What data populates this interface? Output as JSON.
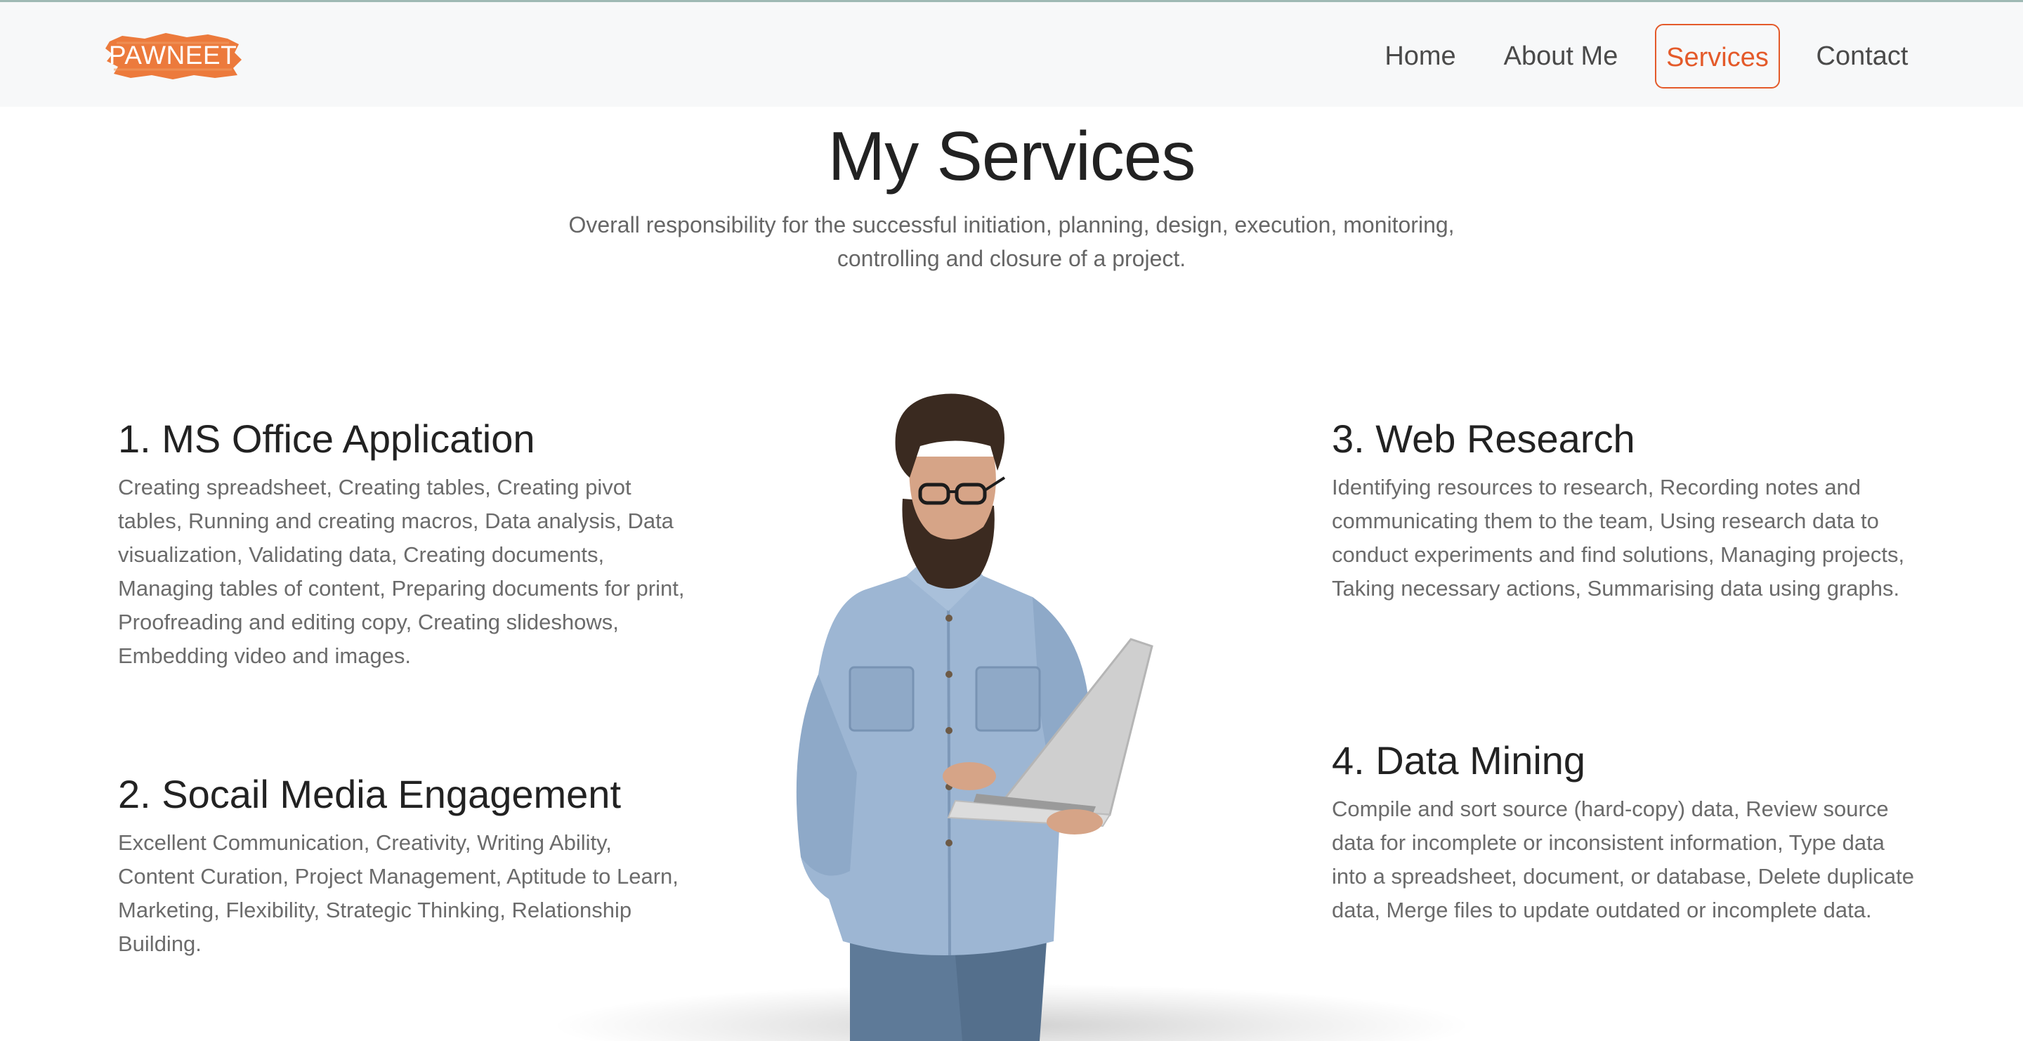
{
  "brand": {
    "logo_text": "PAWNEET",
    "accent_color": "#e45a2a"
  },
  "nav": {
    "items": [
      {
        "label": "Home",
        "active": false
      },
      {
        "label": "About Me",
        "active": false
      },
      {
        "label": "Services",
        "active": true
      },
      {
        "label": "Contact",
        "active": false
      }
    ]
  },
  "header": {
    "title": "My Services",
    "subtitle": "Overall responsibility for the successful initiation, planning, design, execution, monitoring, controlling and closure of a project."
  },
  "services": [
    {
      "title": "1. MS Office Application",
      "description": "Creating spreadsheet, Creating tables, Creating pivot tables, Running and creating macros, Data analysis, Data visualization, Validating data, Creating documents, Managing tables of content, Preparing documents for print, Proofreading and editing copy, Creating slideshows, Embedding video and images."
    },
    {
      "title": "2. Socail Media Engagement",
      "description": "Excellent Communication, Creativity, Writing Ability, Content Curation, Project Management, Aptitude to Learn, Marketing, Flexibility, Strategic Thinking, Relationship Building."
    },
    {
      "title": "3. Web Research",
      "description": "Identifying resources to research, Recording notes and communicating them to the team, Using research data to conduct experiments and find solutions, Managing projects, Taking necessary actions, Summarising data using graphs."
    },
    {
      "title": "4. Data Mining",
      "description": "Compile and sort source (hard-copy) data, Review source data for incomplete or inconsistent information, Type data into a spreadsheet, document, or database, Delete duplicate data, Merge files to update outdated or incomplete data."
    }
  ],
  "illustration": {
    "icon": "man-with-laptop-illustration"
  }
}
